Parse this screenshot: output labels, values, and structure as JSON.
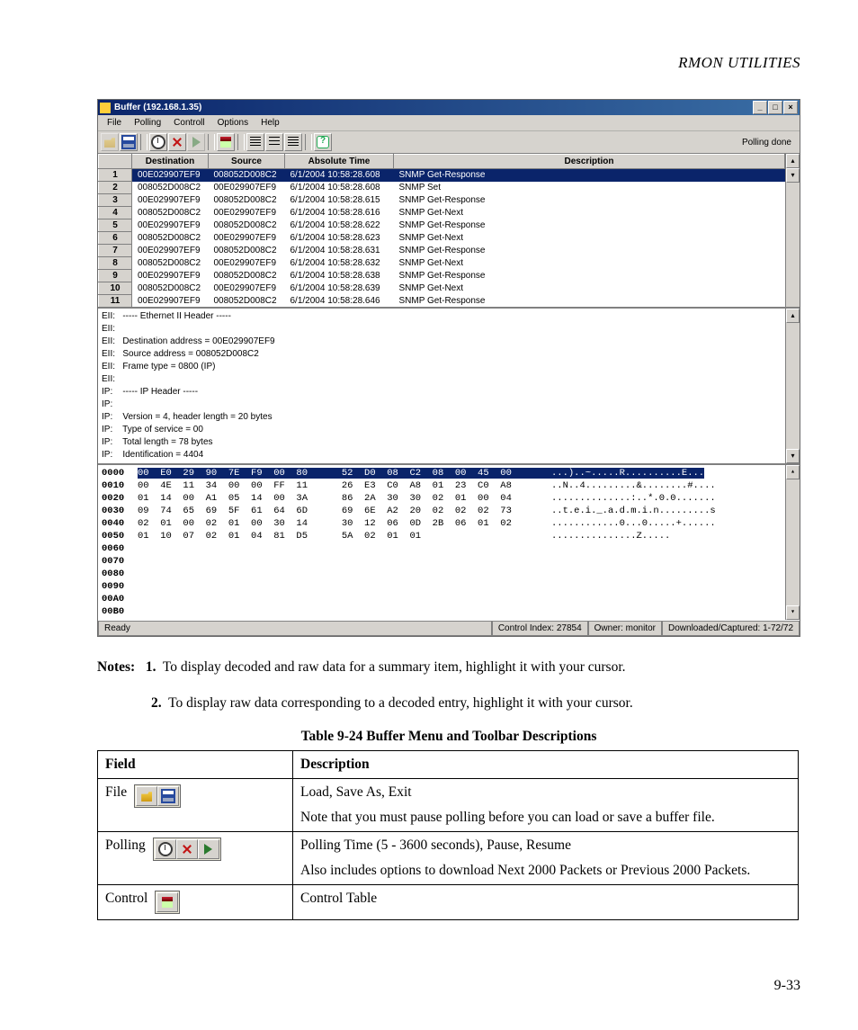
{
  "header": {
    "title": "RMON UTILITIES"
  },
  "app": {
    "title": "Buffer (192.168.1.35)",
    "menus": [
      "File",
      "Polling",
      "Controll",
      "Options",
      "Help"
    ],
    "polling_status": "Polling done",
    "columns": [
      "",
      "Destination",
      "Source",
      "Absolute Time",
      "Description"
    ],
    "rows": [
      {
        "n": "1",
        "dest": "00E029907EF9",
        "src": "008052D008C2",
        "time": "6/1/2004 10:58:28.608",
        "desc": "SNMP Get-Response"
      },
      {
        "n": "2",
        "dest": "008052D008C2",
        "src": "00E029907EF9",
        "time": "6/1/2004 10:58:28.608",
        "desc": "SNMP Set"
      },
      {
        "n": "3",
        "dest": "00E029907EF9",
        "src": "008052D008C2",
        "time": "6/1/2004 10:58:28.615",
        "desc": "SNMP Get-Response"
      },
      {
        "n": "4",
        "dest": "008052D008C2",
        "src": "00E029907EF9",
        "time": "6/1/2004 10:58:28.616",
        "desc": "SNMP Get-Next"
      },
      {
        "n": "5",
        "dest": "00E029907EF9",
        "src": "008052D008C2",
        "time": "6/1/2004 10:58:28.622",
        "desc": "SNMP Get-Response"
      },
      {
        "n": "6",
        "dest": "008052D008C2",
        "src": "00E029907EF9",
        "time": "6/1/2004 10:58:28.623",
        "desc": "SNMP Get-Next"
      },
      {
        "n": "7",
        "dest": "00E029907EF9",
        "src": "008052D008C2",
        "time": "6/1/2004 10:58:28.631",
        "desc": "SNMP Get-Response"
      },
      {
        "n": "8",
        "dest": "008052D008C2",
        "src": "00E029907EF9",
        "time": "6/1/2004 10:58:28.632",
        "desc": "SNMP Get-Next"
      },
      {
        "n": "9",
        "dest": "00E029907EF9",
        "src": "008052D008C2",
        "time": "6/1/2004 10:58:28.638",
        "desc": "SNMP Get-Response"
      },
      {
        "n": "10",
        "dest": "008052D008C2",
        "src": "00E029907EF9",
        "time": "6/1/2004 10:58:28.639",
        "desc": "SNMP Get-Next"
      },
      {
        "n": "11",
        "dest": "00E029907EF9",
        "src": "008052D008C2",
        "time": "6/1/2004 10:58:28.646",
        "desc": "SNMP Get-Response"
      }
    ],
    "decode": [
      "EII:   ----- Ethernet II Header -----",
      "EII:",
      "EII:   Destination address = 00E029907EF9",
      "EII:   Source address = 008052D008C2",
      "EII:   Frame type = 0800 (IP)",
      "EII:",
      "IP:    ----- IP Header -----",
      "IP:",
      "IP:    Version = 4, header length = 20 bytes",
      "IP:    Type of service = 00",
      "IP:    Total length = 78 bytes",
      "IP:    Identification = 4404"
    ],
    "hex": [
      {
        "off": "0000",
        "b1": "00  E0  29  90  7E  F9  00  80",
        "b2": "52  D0  08  C2  08  00  45  00",
        "ascii": "...)..~.....R..........E...",
        "sel": true
      },
      {
        "off": "0010",
        "b1": "00  4E  11  34  00  00  FF  11",
        "b2": "26  E3  C0  A8  01  23  C0  A8",
        "ascii": "..N..4.........&........#....",
        "sel": false
      },
      {
        "off": "0020",
        "b1": "01  14  00  A1  05  14  00  3A",
        "b2": "86  2A  30  30  02  01  00  04",
        "ascii": "..............:..*.0.0.......",
        "sel": false
      },
      {
        "off": "0030",
        "b1": "09  74  65  69  5F  61  64  6D",
        "b2": "69  6E  A2  20  02  02  02  73",
        "ascii": "..t.e.i._.a.d.m.i.n.........s",
        "sel": false
      },
      {
        "off": "0040",
        "b1": "02  01  00  02  01  00  30  14",
        "b2": "30  12  06  0D  2B  06  01  02",
        "ascii": "............0...0.....+......",
        "sel": false
      },
      {
        "off": "0050",
        "b1": "01  10  07  02  01  04  81  D5",
        "b2": "5A  02  01  01",
        "ascii": "...............Z.....",
        "sel": false
      },
      {
        "off": "0060",
        "b1": "",
        "b2": "",
        "ascii": "",
        "sel": false
      },
      {
        "off": "0070",
        "b1": "",
        "b2": "",
        "ascii": "",
        "sel": false
      },
      {
        "off": "0080",
        "b1": "",
        "b2": "",
        "ascii": "",
        "sel": false
      },
      {
        "off": "0090",
        "b1": "",
        "b2": "",
        "ascii": "",
        "sel": false
      },
      {
        "off": "00A0",
        "b1": "",
        "b2": "",
        "ascii": "",
        "sel": false
      },
      {
        "off": "00B0",
        "b1": "",
        "b2": "",
        "ascii": "",
        "sel": false
      }
    ],
    "status": {
      "ready": "Ready",
      "control_index": "Control Index: 27854",
      "owner": "Owner: monitor",
      "downloaded": "Downloaded/Captured: 1-72/72"
    }
  },
  "notes": {
    "intro": "Notes:",
    "n1": "1.",
    "t1": "To display decoded and raw data for a summary item, highlight it with your cursor.",
    "n2": "2.",
    "t2": "To display raw data corresponding to a decoded entry, highlight it with your cursor."
  },
  "table": {
    "caption": "Table 9-24  Buffer Menu and Toolbar Descriptions",
    "h1": "Field",
    "h2": "Description",
    "rows": [
      {
        "field": "File",
        "desc1": "Load, Save As, Exit",
        "desc2": "Note that you must pause polling before you can load or save a buffer file."
      },
      {
        "field": "Polling",
        "desc1": "Polling Time (5 - 3600 seconds), Pause, Resume",
        "desc2": "Also includes options to download Next 2000 Packets or Previous 2000 Packets."
      },
      {
        "field": "Control",
        "desc1": "Control Table",
        "desc2": ""
      }
    ]
  },
  "page_number": "9-33"
}
